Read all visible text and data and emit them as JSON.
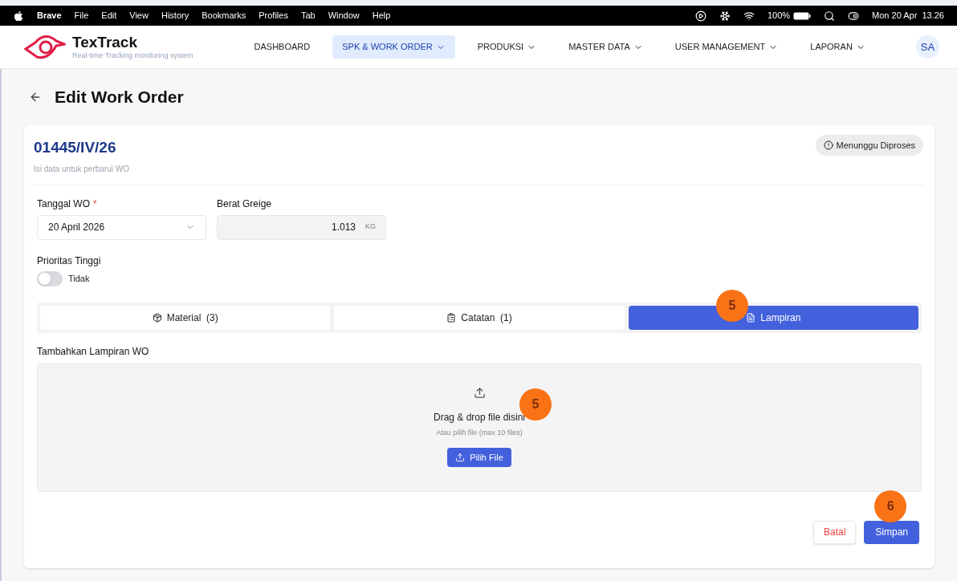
{
  "menubar": {
    "app": "Brave",
    "items": [
      "File",
      "Edit",
      "View",
      "History",
      "Bookmarks",
      "Profiles",
      "Tab",
      "Window",
      "Help"
    ],
    "battery": "100%",
    "clock": "Mon 20 Apr  13.26"
  },
  "header": {
    "brand": "TexTrack",
    "tagline": "Real-time Tracking monitoring system",
    "nav": [
      {
        "label": "DASHBOARD",
        "selected": false,
        "dropdown": false
      },
      {
        "label": "SPK & WORK ORDER",
        "selected": true,
        "dropdown": true
      },
      {
        "label": "PRODUKSI",
        "selected": false,
        "dropdown": true
      },
      {
        "label": "MASTER DATA",
        "selected": false,
        "dropdown": true
      },
      {
        "label": "USER MANAGEMENT",
        "selected": false,
        "dropdown": true
      },
      {
        "label": "LAPORAN",
        "selected": false,
        "dropdown": true
      }
    ],
    "avatar": "SA"
  },
  "page": {
    "title": "Edit Work Order",
    "wo_number": "01445/IV/26",
    "subtitle": "Isi data untuk perbarui WO",
    "status": "Menunggu Diproses"
  },
  "form": {
    "date": {
      "label": "Tanggal WO",
      "required_mark": "*",
      "value": "20 April 2026"
    },
    "weight": {
      "label": "Berat Greige",
      "value": "1.013",
      "unit": "KG"
    },
    "priority": {
      "label": "Prioritas Tinggi",
      "on": false,
      "value_label": "Tidak"
    }
  },
  "tabs": [
    {
      "label": "Material  (3)",
      "kind": "material",
      "selected": false
    },
    {
      "label": "Catatan  (1)",
      "kind": "notes",
      "selected": false
    },
    {
      "label": "Lampiran",
      "kind": "attachment",
      "selected": true
    }
  ],
  "upload": {
    "label": "Tambahkan Lampiran WO",
    "title": "Drag & drop file disini",
    "hint": "Atau pilih file (max 10 files)",
    "button": "Pilih File"
  },
  "actions": {
    "cancel": "Batal",
    "save": "Simpan"
  },
  "markers": [
    "5",
    "5",
    "6"
  ]
}
